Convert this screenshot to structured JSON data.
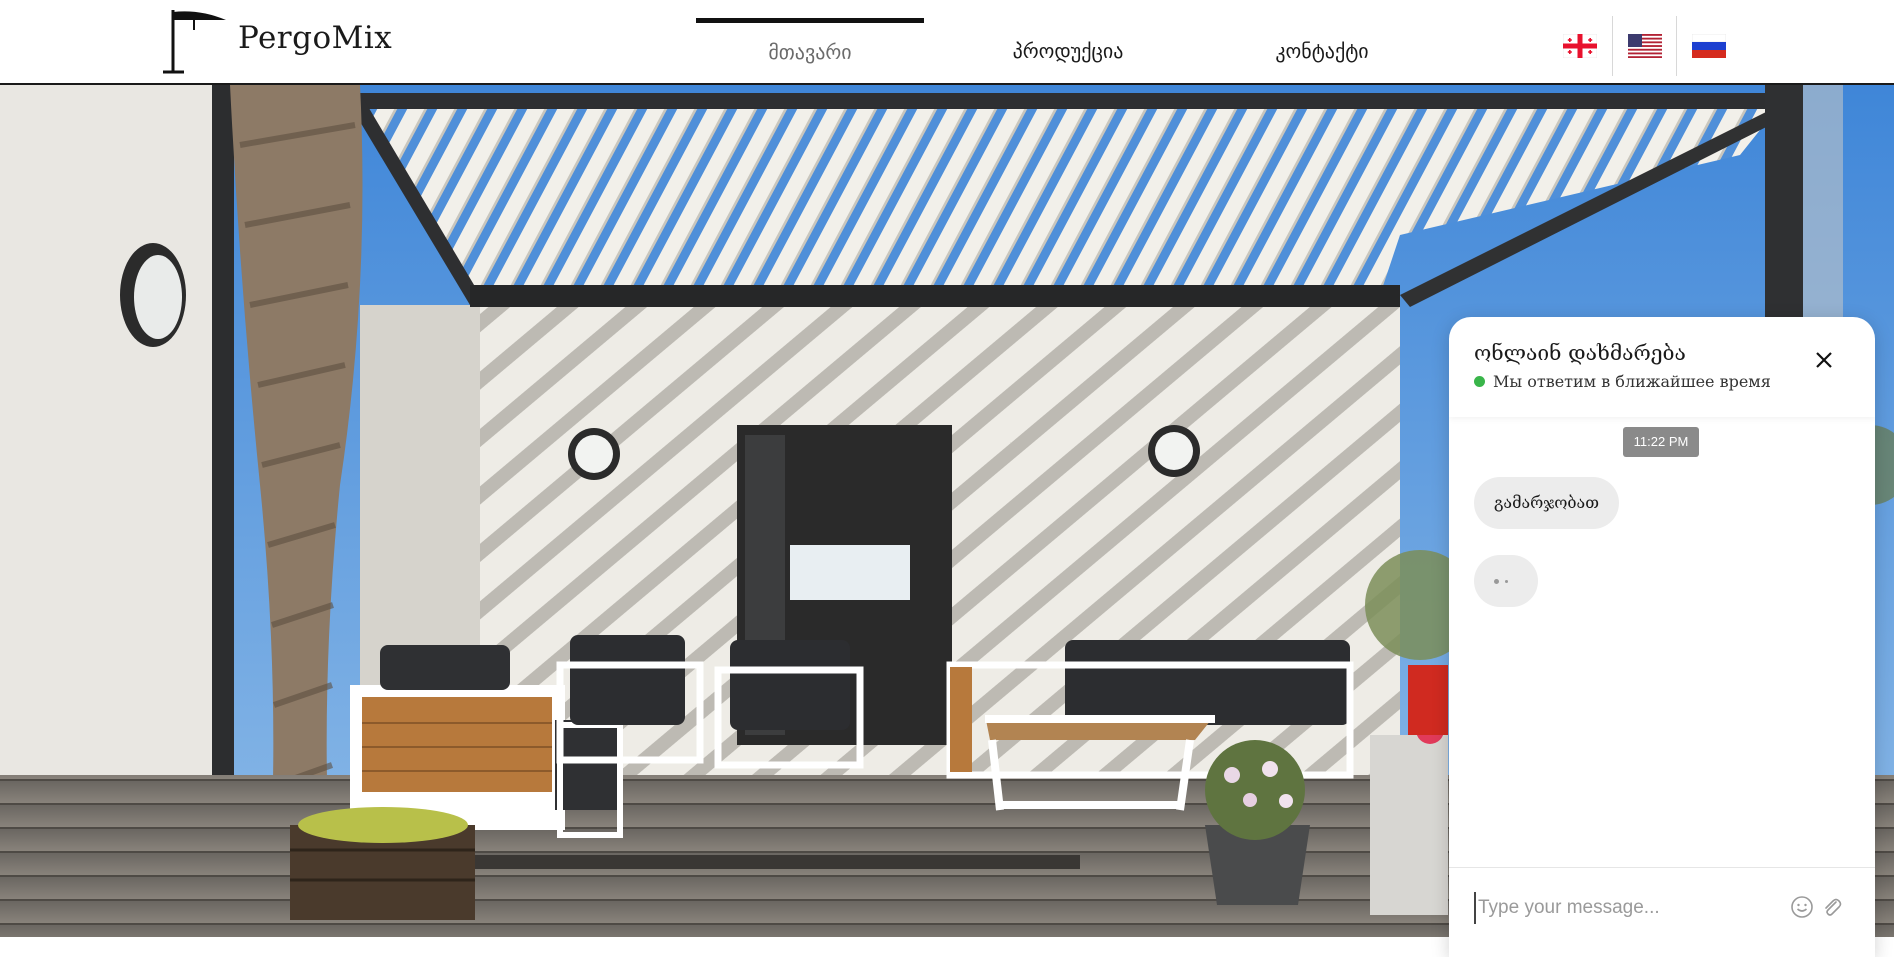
{
  "brand": {
    "name": "PergoMix"
  },
  "nav": {
    "items": [
      {
        "label": "მთავარი",
        "active": true
      },
      {
        "label": "პროდუქცია",
        "active": false
      },
      {
        "label": "კონტაქტი",
        "active": false
      }
    ]
  },
  "languages": [
    {
      "code": "ka",
      "icon": "georgia-flag-icon"
    },
    {
      "code": "en",
      "icon": "usa-flag-icon"
    },
    {
      "code": "ru",
      "icon": "russia-flag-icon"
    }
  ],
  "chat": {
    "title": "ონლაინ დახმარება",
    "status": "Мы ответим в ближайшее время",
    "status_color": "#39b54a",
    "time": "11:22 PM",
    "message": "გამარჯობათ",
    "input_placeholder": "Type your message...",
    "icons": {
      "close": "close-icon",
      "emoji": "emoji-icon",
      "attach": "paperclip-icon"
    }
  }
}
